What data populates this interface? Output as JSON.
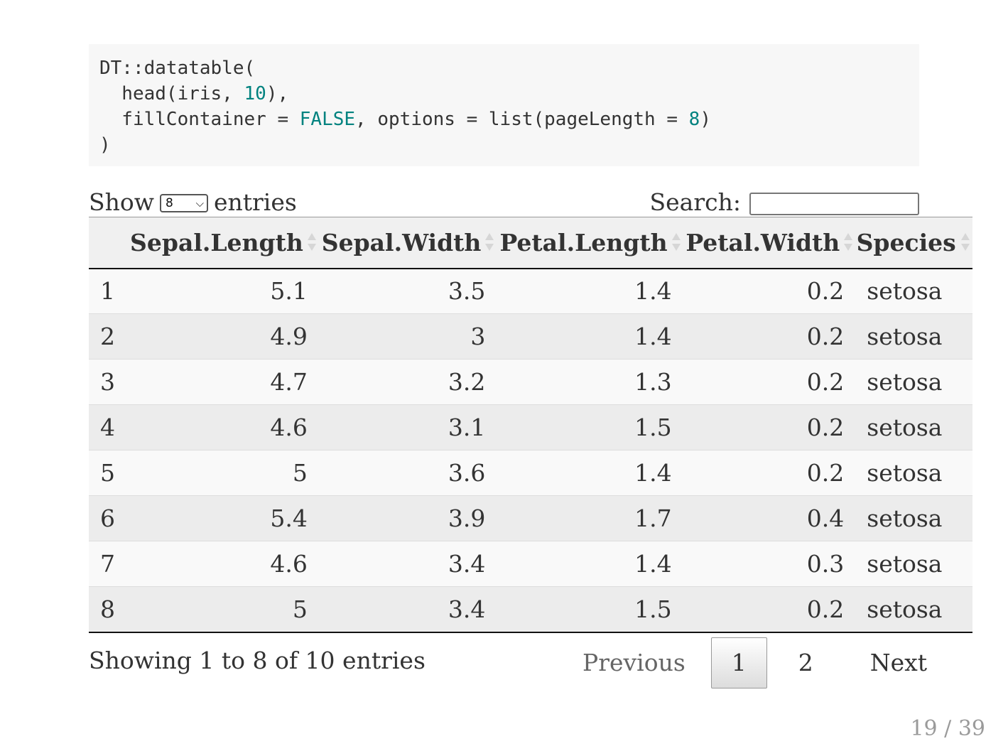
{
  "code": {
    "lines": [
      [
        {
          "t": "DT::datatable(",
          "c": ""
        }
      ],
      [
        {
          "t": "  head(iris, ",
          "c": ""
        },
        {
          "t": "10",
          "c": "num"
        },
        {
          "t": "),",
          "c": ""
        }
      ],
      [
        {
          "t": "  fillContainer = ",
          "c": ""
        },
        {
          "t": "FALSE",
          "c": "bool"
        },
        {
          "t": ", options = list(pageLength = ",
          "c": ""
        },
        {
          "t": "8",
          "c": "num"
        },
        {
          "t": ")",
          "c": ""
        }
      ],
      [
        {
          "t": ")",
          "c": ""
        }
      ]
    ]
  },
  "length_control": {
    "show_label": "Show",
    "selected": "8",
    "entries_label": "entries"
  },
  "search": {
    "label": "Search:",
    "value": ""
  },
  "table": {
    "columns": [
      {
        "label": "",
        "align": "left",
        "sortable": false
      },
      {
        "label": "Sepal.Length",
        "align": "num",
        "sortable": true
      },
      {
        "label": "Sepal.Width",
        "align": "num",
        "sortable": true
      },
      {
        "label": "Petal.Length",
        "align": "num",
        "sortable": true
      },
      {
        "label": "Petal.Width",
        "align": "num",
        "sortable": true
      },
      {
        "label": "Species",
        "align": "left",
        "sortable": true
      }
    ],
    "rows": [
      [
        "1",
        "5.1",
        "3.5",
        "1.4",
        "0.2",
        "setosa"
      ],
      [
        "2",
        "4.9",
        "3",
        "1.4",
        "0.2",
        "setosa"
      ],
      [
        "3",
        "4.7",
        "3.2",
        "1.3",
        "0.2",
        "setosa"
      ],
      [
        "4",
        "4.6",
        "3.1",
        "1.5",
        "0.2",
        "setosa"
      ],
      [
        "5",
        "5",
        "3.6",
        "1.4",
        "0.2",
        "setosa"
      ],
      [
        "6",
        "5.4",
        "3.9",
        "1.7",
        "0.4",
        "setosa"
      ],
      [
        "7",
        "4.6",
        "3.4",
        "1.4",
        "0.3",
        "setosa"
      ],
      [
        "8",
        "5",
        "3.4",
        "1.5",
        "0.2",
        "setosa"
      ]
    ]
  },
  "info": "Showing 1 to 8 of 10 entries",
  "pagination": {
    "previous": "Previous",
    "pages": [
      "1",
      "2"
    ],
    "current": "1",
    "next": "Next"
  },
  "slide_number": "19 / 39",
  "colors": {
    "code_background": "#f7f7f7",
    "code_literal": "#00827f",
    "row_odd": "#f9f9f9",
    "row_even": "#ececec",
    "header_background": "#f0f0f0"
  }
}
